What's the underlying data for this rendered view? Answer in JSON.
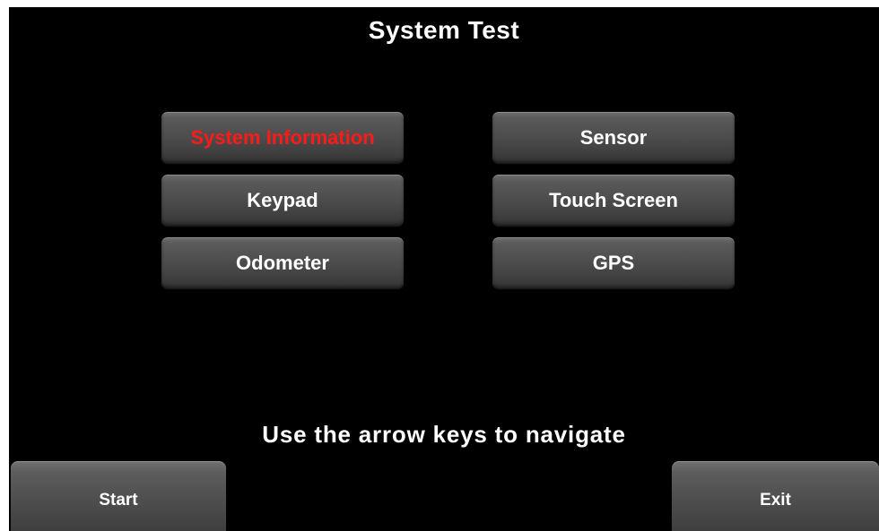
{
  "screen": {
    "title": "System Test",
    "hint": "Use the arrow keys to navigate"
  },
  "menu": {
    "items": [
      {
        "label": "System Information",
        "selected": true
      },
      {
        "label": "Sensor",
        "selected": false
      },
      {
        "label": "Keypad",
        "selected": false
      },
      {
        "label": "Touch Screen",
        "selected": false
      },
      {
        "label": "Odometer",
        "selected": false
      },
      {
        "label": "GPS",
        "selected": false
      }
    ]
  },
  "footer": {
    "start_label": "Start",
    "exit_label": "Exit"
  },
  "colors": {
    "background": "#000000",
    "text": "#ffffff",
    "selected_text": "#ff1a1a",
    "button": "#4a4a4a"
  }
}
